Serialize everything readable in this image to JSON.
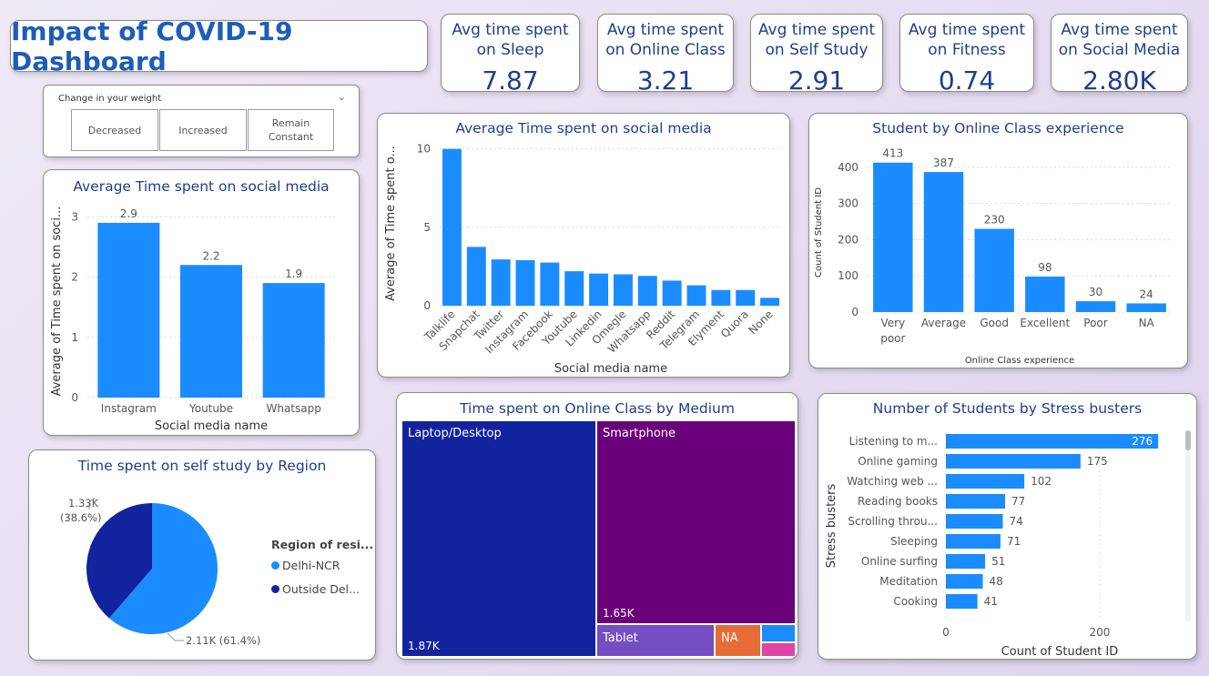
{
  "dashboard": {
    "title": "Impact of COVID-19 Dashboard"
  },
  "kpis": [
    {
      "label1": "Avg time spent",
      "label2": "on Sleep",
      "value": "7.87"
    },
    {
      "label1": "Avg time spent",
      "label2": "on Online Class",
      "value": "3.21"
    },
    {
      "label1": "Avg time spent",
      "label2": "on Self Study",
      "value": "2.91"
    },
    {
      "label1": "Avg time spent",
      "label2": "on Fitness",
      "value": "0.74"
    },
    {
      "label1": "Avg time spent",
      "label2": "on Social Media",
      "value": "2.80K"
    }
  ],
  "slicer": {
    "header": "Change in your weight",
    "options": [
      {
        "line1": "Decreased",
        "line2": ""
      },
      {
        "line1": "Increased",
        "line2": ""
      },
      {
        "line1": "Remain",
        "line2": "Constant"
      }
    ]
  },
  "colors": {
    "bar": "#1a8cff",
    "kpi_text": "#1d3f8f",
    "title_blue": "#1c5db8",
    "pie_light": "#1a8cff",
    "pie_dark": "#12239e",
    "laptop": "#12239e",
    "smartphone": "#6b007b",
    "tablet": "#744ec2",
    "na": "#e66c37",
    "small1": "#1a8cff",
    "small2": "#e044a7"
  },
  "chart_data": [
    {
      "id": "social_small",
      "type": "bar",
      "title": "Average Time spent on social media",
      "xlabel": "Social media name",
      "ylabel": "Average of Time spent on soci...",
      "categories": [
        "Instagram",
        "Youtube",
        "Whatsapp"
      ],
      "values": [
        2.9,
        2.2,
        1.9
      ],
      "data_labels": [
        "2.9",
        "2.2",
        "1.9"
      ],
      "ylim": [
        0,
        3.2
      ],
      "yticks": [
        0,
        1,
        2,
        3
      ],
      "grid": true
    },
    {
      "id": "social_all",
      "type": "bar",
      "title": "Average Time spent on social media",
      "xlabel": "Social media name",
      "ylabel": "Average of Time spent o...",
      "categories": [
        "Talklife",
        "Snapchat",
        "Twitter",
        "Instagram",
        "Facebook",
        "Youtube",
        "Linkedin",
        "Omegle",
        "Whatsapp",
        "Reddit",
        "Telegram",
        "Elyment",
        "Quora",
        "None"
      ],
      "values": [
        10.0,
        3.75,
        2.95,
        2.9,
        2.75,
        2.2,
        2.05,
        2.0,
        1.9,
        1.6,
        1.3,
        1.0,
        1.0,
        0.5
      ],
      "ylim": [
        0,
        10.5
      ],
      "yticks": [
        0,
        5,
        10
      ],
      "grid": true
    },
    {
      "id": "online_exp",
      "type": "bar",
      "title": "Student by Online Class experience",
      "xlabel": "Online Class experience",
      "ylabel": "Count of Student ID",
      "categories": [
        "Very poor",
        "Average",
        "Good",
        "Excellent",
        "Poor",
        "NA"
      ],
      "category_lines": [
        [
          "Very",
          "poor"
        ],
        [
          "Average"
        ],
        [
          "Good"
        ],
        [
          "Excellent"
        ],
        [
          "Poor"
        ],
        [
          "NA"
        ]
      ],
      "values": [
        413,
        387,
        230,
        98,
        30,
        24
      ],
      "data_labels": [
        "413",
        "387",
        "230",
        "98",
        "30",
        "24"
      ],
      "ylim": [
        0,
        440
      ],
      "yticks": [
        0,
        100,
        200,
        300,
        400
      ],
      "grid": true
    },
    {
      "id": "self_study_region",
      "type": "pie",
      "title": "Time spent on self study by Region",
      "legend_title": "Region of resi...",
      "slices": [
        {
          "name": "Delhi-NCR",
          "legend": "Delhi-NCR",
          "value": 2110,
          "label1": "2.11K (61.4%)",
          "label2": ""
        },
        {
          "name": "Outside Delhi-NCR",
          "legend": "Outside Del...",
          "value": 1330,
          "label1": "1.33K",
          "label2": "(38.6%)"
        }
      ]
    },
    {
      "id": "online_medium",
      "type": "treemap",
      "title": "Time spent on Online Class by Medium",
      "items": [
        {
          "name": "Laptop/Desktop",
          "value": 1870,
          "value_label": "1.87K"
        },
        {
          "name": "Smartphone",
          "value": 1650,
          "value_label": "1.65K"
        },
        {
          "name": "Tablet",
          "value_label": ""
        },
        {
          "name": "NA",
          "value_label": ""
        }
      ]
    },
    {
      "id": "stress_busters",
      "type": "bar",
      "orientation": "horizontal",
      "title": "Number of Students by Stress busters",
      "xlabel": "Count of Student ID",
      "ylabel": "Stress busters",
      "categories": [
        "Listening to m...",
        "Online gaming",
        "Watching web ...",
        "Reading books",
        "Scrolling throu...",
        "Sleeping",
        "Online surfing",
        "Meditation",
        "Cooking"
      ],
      "values": [
        276,
        175,
        102,
        77,
        74,
        71,
        51,
        48,
        41
      ],
      "data_labels": [
        "276",
        "175",
        "102",
        "77",
        "74",
        "71",
        "51",
        "48",
        "41"
      ],
      "xlim": [
        0,
        290
      ],
      "xticks": [
        0,
        200
      ],
      "grid": true
    }
  ]
}
